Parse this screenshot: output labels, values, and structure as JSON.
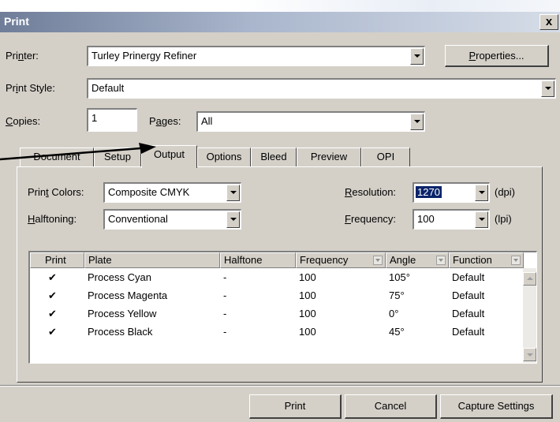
{
  "window": {
    "title": "Print",
    "close_glyph": "x"
  },
  "printer": {
    "label_pre": "Pri",
    "label_u": "n",
    "label_post": "ter:",
    "value": "Turley Prinergy Refiner",
    "properties_u": "P",
    "properties_rest": "roperties..."
  },
  "print_style": {
    "label_pre": "Pr",
    "label_u": "i",
    "label_post": "nt Style:",
    "value": "Default"
  },
  "copies": {
    "label_u": "C",
    "label_rest": "opies:",
    "value": "1"
  },
  "pages": {
    "label_pre": "P",
    "label_u": "a",
    "label_post": "ges:",
    "value": "All"
  },
  "tabs": [
    "Document",
    "Setup",
    "Output",
    "Options",
    "Bleed",
    "Preview",
    "OPI"
  ],
  "output": {
    "print_colors": {
      "label_pre": "Prin",
      "label_u": "t",
      "label_post": " Colors:",
      "value": "Composite CMYK"
    },
    "halftoning": {
      "label_u": "H",
      "label_rest": "alftoning:",
      "value": "Conventional"
    },
    "resolution": {
      "label_u": "R",
      "label_rest": "esolution:",
      "value": "1270",
      "unit": "(dpi)"
    },
    "frequency": {
      "label_u": "F",
      "label_rest": "requency:",
      "value": "100",
      "unit": "(lpi)"
    }
  },
  "plates_table": {
    "columns": [
      "Print",
      "Plate",
      "Halftone",
      "Frequency",
      "Angle",
      "Function"
    ],
    "rows": [
      {
        "print": "✔",
        "plate": "Process Cyan",
        "halftone": "-",
        "frequency": "100",
        "angle": "105°",
        "function": "Default"
      },
      {
        "print": "✔",
        "plate": "Process Magenta",
        "halftone": "-",
        "frequency": "100",
        "angle": "75°",
        "function": "Default"
      },
      {
        "print": "✔",
        "plate": "Process Yellow",
        "halftone": "-",
        "frequency": "100",
        "angle": "0°",
        "function": "Default"
      },
      {
        "print": "✔",
        "plate": "Process Black",
        "halftone": "-",
        "frequency": "100",
        "angle": "45°",
        "function": "Default"
      }
    ]
  },
  "buttons": {
    "print": "Print",
    "cancel": "Cancel",
    "capture": "Capture Settings"
  },
  "colors": {
    "face": "#d4d0c8",
    "title_gradient_start": "#6f7d99",
    "selection": "#0a246a",
    "annotation_arrow": "#000000"
  }
}
